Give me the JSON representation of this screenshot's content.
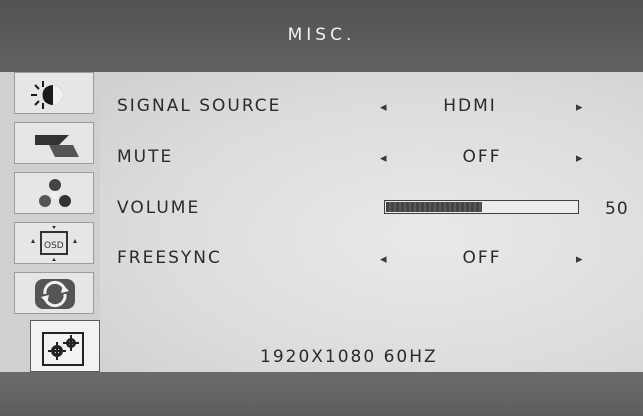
{
  "osd": {
    "title": "MISC.",
    "sidebar": [
      {
        "icon": "brightness-contrast-icon"
      },
      {
        "icon": "image-setup-icon"
      },
      {
        "icon": "color-temperature-icon"
      },
      {
        "icon": "osd-settings-icon"
      },
      {
        "icon": "reset-icon"
      },
      {
        "icon": "misc-settings-icon",
        "active": true
      }
    ],
    "rows": {
      "signal_source": {
        "label": "SIGNAL SOURCE",
        "value": "HDMI",
        "left_arrow": "◂",
        "right_arrow": "▸"
      },
      "mute": {
        "label": "MUTE",
        "value": "OFF",
        "left_arrow": "◂",
        "right_arrow": "▸"
      },
      "volume": {
        "label": "VOLUME",
        "value": "50",
        "level": 0.5
      },
      "freesync": {
        "label": "FREESYNC",
        "value": "OFF",
        "left_arrow": "◂",
        "right_arrow": "▸"
      }
    },
    "status": "1920X1080 60HZ"
  }
}
